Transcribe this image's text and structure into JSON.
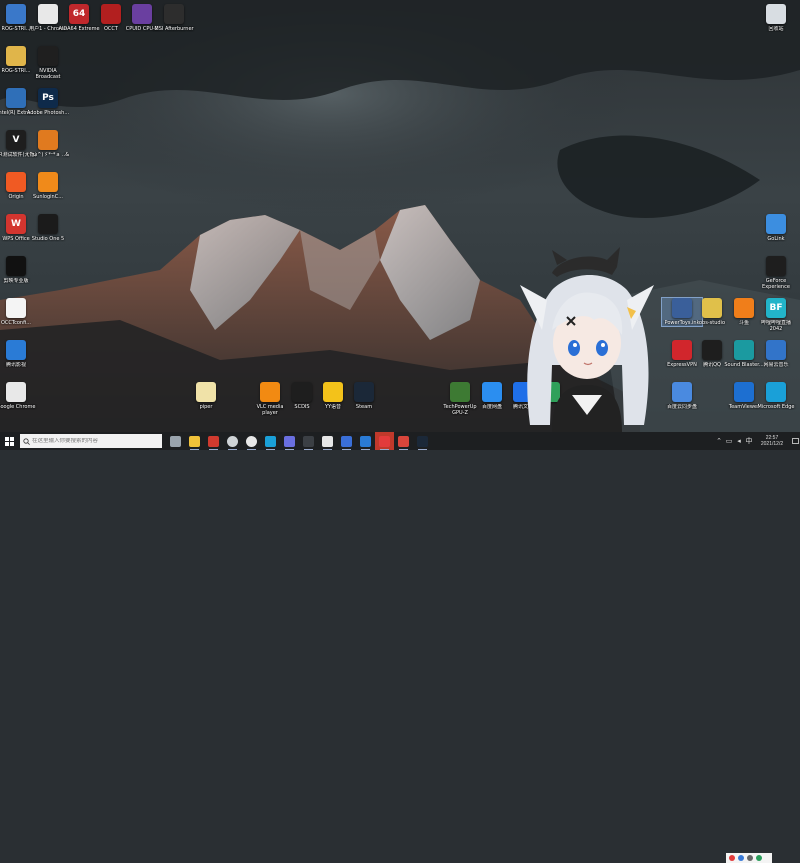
{
  "desktop": {
    "icons_left": [
      {
        "label": "ROG-STRI...",
        "icon": "document-icon",
        "color": "#3a78c9",
        "glyph": ""
      },
      {
        "label": "用户1 - Chrome",
        "icon": "chrome-icon",
        "color": "#e8e8e8",
        "glyph": ""
      },
      {
        "label": "AIDA64 Extreme",
        "icon": "aida64-icon",
        "color": "#c0282c",
        "glyph": "64"
      },
      {
        "label": "OCCT",
        "icon": "occt-icon",
        "color": "#b21f1f",
        "glyph": ""
      },
      {
        "label": "CPUID CPU-Z",
        "icon": "cpuz-icon",
        "color": "#6a3fa0",
        "glyph": ""
      },
      {
        "label": "MSI Afterburner",
        "icon": "afterburner-icon",
        "color": "#2d2d2d",
        "glyph": ""
      },
      {
        "label": "ROG-STRI...",
        "icon": "zip-icon",
        "color": "#e0b54a",
        "glyph": ""
      },
      {
        "label": "NVIDIA Broadcast",
        "icon": "nvidia-broadcast-icon",
        "color": "#1f1f1f",
        "glyph": ""
      },
      {
        "label": "Intel(R) Extre...",
        "icon": "intel-xtu-icon",
        "color": "#2f6fb8",
        "glyph": ""
      },
      {
        "label": "Adobe Photosh...",
        "icon": "photoshop-icon",
        "color": "#0e2a4a",
        "glyph": "Ps"
      },
      {
        "label": "CR测试软件(大锤)",
        "icon": "yellow-v-icon",
        "color": "#1e1e1e",
        "glyph": "V"
      },
      {
        "label": "(^ω^)ゞ*ᵕ*ａ ..&",
        "icon": "app-icon",
        "color": "#e07a1f",
        "glyph": ""
      },
      {
        "label": "Origin",
        "icon": "origin-icon",
        "color": "#f05a23",
        "glyph": ""
      },
      {
        "label": "SunloginC...",
        "icon": "sunlogin-icon",
        "color": "#f08a1a",
        "glyph": ""
      },
      {
        "label": "WPS Office",
        "icon": "wps-icon",
        "color": "#d3352f",
        "glyph": "W"
      },
      {
        "label": "Studio One 5",
        "icon": "studio-one-icon",
        "color": "#1b1b1b",
        "glyph": ""
      },
      {
        "label": "剪映专业版",
        "icon": "capcut-icon",
        "color": "#111111",
        "glyph": ""
      },
      {
        "label": "OCCTconfi...",
        "icon": "document-icon",
        "color": "#f4f4f4",
        "glyph": ""
      },
      {
        "label": "腾讯影视",
        "icon": "tencent-icon",
        "color": "#2a7bd6",
        "glyph": ""
      },
      {
        "label": "Google Chrome",
        "icon": "chrome-icon",
        "color": "#e8e8e8",
        "glyph": ""
      }
    ],
    "icons_bottom": [
      {
        "label": "piper",
        "icon": "document-icon",
        "color": "#f0e2a8",
        "glyph": ""
      },
      {
        "label": "VLC media player",
        "icon": "vlc-icon",
        "color": "#f28a12",
        "glyph": ""
      },
      {
        "label": "SCDIS",
        "icon": "disc-icon",
        "color": "#1e1e1e",
        "glyph": ""
      },
      {
        "label": "YY语音",
        "icon": "yy-icon",
        "color": "#f3c21a",
        "glyph": ""
      },
      {
        "label": "Steam",
        "icon": "steam-icon",
        "color": "#1b2838",
        "glyph": ""
      },
      {
        "label": "TechPowerUp GPU-Z",
        "icon": "gpuz-icon",
        "color": "#3d7a33",
        "glyph": ""
      },
      {
        "label": "百度网盘",
        "icon": "baidu-pan-icon",
        "color": "#2b8ef0",
        "glyph": ""
      },
      {
        "label": "腾讯文档",
        "icon": "tencent-docs-icon",
        "color": "#1f6fe8",
        "glyph": ""
      },
      {
        "label": "",
        "icon": "app-icon",
        "color": "#2fa05a",
        "glyph": ""
      }
    ],
    "icons_right": [
      {
        "label": "回收站",
        "icon": "recycle-bin-icon",
        "color": "#d8dde2",
        "glyph": ""
      },
      {
        "label": "GoLink",
        "icon": "golink-icon",
        "color": "#3c8ee0",
        "glyph": ""
      },
      {
        "label": "GeForce Experience",
        "icon": "geforce-icon",
        "color": "#1e1e1e",
        "glyph": ""
      },
      {
        "label": "PowerToys.ink",
        "icon": "disc-icon",
        "color": "#3a5f9a",
        "glyph": ""
      },
      {
        "label": "obs-studio",
        "icon": "zip-icon",
        "color": "#e0c04a",
        "glyph": ""
      },
      {
        "label": "斗鱼",
        "icon": "app-icon",
        "color": "#f07e1a",
        "glyph": ""
      },
      {
        "label": "哔哩哔哩直播 2042",
        "icon": "bilibili-icon",
        "color": "#22b4c9",
        "glyph": "BF"
      },
      {
        "label": "ExpressVPN",
        "icon": "expressvpn-icon",
        "color": "#d1262c",
        "glyph": ""
      },
      {
        "label": "腾讯QQ",
        "icon": "qq-icon",
        "color": "#1e1e1e",
        "glyph": ""
      },
      {
        "label": "Sound Blaster...",
        "icon": "sound-blaster-icon",
        "color": "#1b9aa0",
        "glyph": ""
      },
      {
        "label": "网易云音乐",
        "icon": "cloud-music-icon",
        "color": "#3274c9",
        "glyph": ""
      },
      {
        "label": "百度云同步盘",
        "icon": "app-icon",
        "color": "#4a8ae0",
        "glyph": ""
      },
      {
        "label": "TeamViewer",
        "icon": "teamviewer-icon",
        "color": "#1d6fd1",
        "glyph": ""
      },
      {
        "label": "Microsoft Edge",
        "icon": "edge-icon",
        "color": "#1aa0d8",
        "glyph": ""
      }
    ]
  },
  "taskbar": {
    "search_placeholder": "在这里输入你要搜索的内容",
    "apps": [
      {
        "icon": "task-view-icon",
        "color": "#9aa4ad"
      },
      {
        "icon": "file-explorer-icon",
        "color": "#f0c23a"
      },
      {
        "icon": "calendar-icon",
        "color": "#d03a2f"
      },
      {
        "icon": "clock-app-icon",
        "color": "#cfd3d6"
      },
      {
        "icon": "chrome-icon",
        "color": "#e8e8e8"
      },
      {
        "icon": "edge-icon",
        "color": "#1aa0d8"
      },
      {
        "icon": "discord-icon",
        "color": "#6a6fe0"
      },
      {
        "icon": "obs-icon",
        "color": "#3b3f44"
      },
      {
        "icon": "feishu-icon",
        "color": "#e6e6e6"
      },
      {
        "icon": "lark-icon",
        "color": "#3a6fd8"
      },
      {
        "icon": "remote-icon",
        "color": "#2a7bd6"
      },
      {
        "icon": "netease-music-icon",
        "color": "#e23b3b",
        "active": true
      },
      {
        "icon": "game-icon",
        "color": "#d8453b"
      },
      {
        "icon": "steam-icon",
        "color": "#1b2838"
      }
    ],
    "clock": {
      "time": "22:57",
      "date": "2021/12/2"
    },
    "tray_icons": [
      "chevron-up-icon",
      "network-icon",
      "speaker-icon",
      "input-method-icon"
    ]
  }
}
